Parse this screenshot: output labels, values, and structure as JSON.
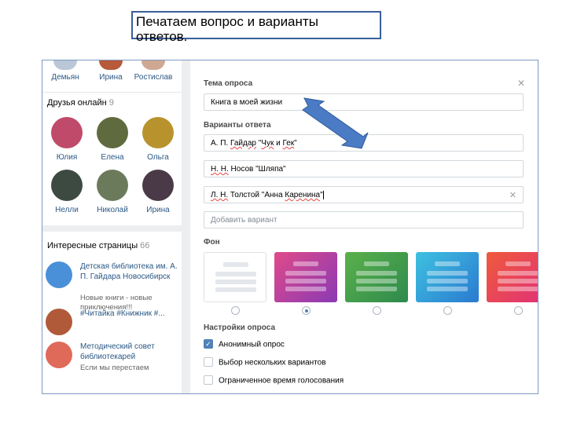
{
  "caption": {
    "line1": "Печатаем вопрос и варианты",
    "line2": "ответов."
  },
  "top_friends": [
    {
      "name": "Демьян"
    },
    {
      "name": "Ирина"
    },
    {
      "name": "Ростислав"
    }
  ],
  "online": {
    "title": "Друзья онлайн",
    "count": "9",
    "friends": [
      {
        "name": "Юлия",
        "color": "#c04a6a"
      },
      {
        "name": "Елена",
        "color": "#5f6a3e"
      },
      {
        "name": "Ольга",
        "color": "#b8922d"
      },
      {
        "name": "Нелли",
        "color": "#3d4a42"
      },
      {
        "name": "Николай",
        "color": "#6c7a5c"
      },
      {
        "name": "Ирина",
        "color": "#4a3a48"
      }
    ]
  },
  "pages": {
    "title": "Интересные страницы",
    "count": "66",
    "items": [
      {
        "title": "Детская библиотека им. А. П. Гайдара Новосибирск",
        "desc": "Новые книги - новые приключения!!!",
        "color": "#4a90d9"
      },
      {
        "title": "#Читайка #Книжник #...",
        "desc": "",
        "color": "#b05a3a"
      },
      {
        "title": "Методический совет библиотекарей",
        "desc": "Если мы перестаем",
        "color": "#e06a5a"
      }
    ]
  },
  "poll": {
    "topic_label": "Тема опроса",
    "topic_value": "Книга в моей жизни",
    "answers_label": "Варианты ответа",
    "answers": [
      {
        "prefix": "А. П. ",
        "sq": "Гайдар",
        "mid": " \"",
        "sq2": "Чук",
        "rest": " и ",
        "sq3": "Гек",
        "end": "\""
      },
      {
        "prefix": "",
        "sq": "Н. Н.",
        "mid": " Носов \"Шляпа\"",
        "sq2": "",
        "rest": "",
        "sq3": "",
        "end": ""
      },
      {
        "prefix": "",
        "sq": "Л. Н.",
        "mid": " Толстой \"Анна ",
        "sq2": "Каренина",
        "rest": "\"",
        "sq3": "",
        "end": ""
      }
    ],
    "add_placeholder": "Добавить вариант",
    "bg_label": "Фон",
    "backgrounds": [
      {
        "gradient": "#ffffff"
      },
      {
        "gradient": "linear-gradient(135deg,#e04a8a,#8a3ab5)"
      },
      {
        "gradient": "linear-gradient(135deg,#5ab14a,#2e8a4e)"
      },
      {
        "gradient": "linear-gradient(135deg,#3ec1e0,#2a7ad0)"
      },
      {
        "gradient": "linear-gradient(135deg,#f05a3a,#e0307a)"
      }
    ],
    "selected_bg_index": 1,
    "settings_label": "Настройки опроса",
    "options": [
      {
        "label": "Анонимный опрос",
        "checked": true
      },
      {
        "label": "Выбор нескольких вариантов",
        "checked": false
      },
      {
        "label": "Ограниченное время голосования",
        "checked": false
      }
    ],
    "icons": {
      "close": "close-icon",
      "clear": "clear-icon",
      "check": "check-icon"
    }
  },
  "colors": {
    "link": "#2a5885",
    "accent": "#5181b8",
    "arrow": "#4a7bc4"
  }
}
